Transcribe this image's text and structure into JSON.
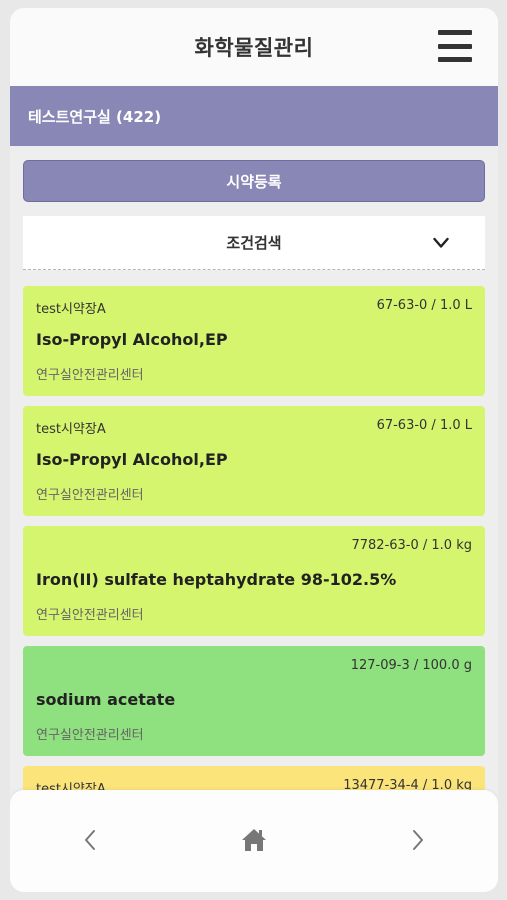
{
  "header": {
    "title": "화학물질관리",
    "menu_icon": "hamburger-menu-icon"
  },
  "lab": {
    "label": "테스트연구실 (422)"
  },
  "register_button": {
    "label": "시약등록"
  },
  "search_panel": {
    "label": "조건검색",
    "toggle_icon": "chevron-down-icon"
  },
  "colors": {
    "accent": "#8987b6",
    "card_yellow_green": "#d6f56f",
    "card_green": "#8fe07e",
    "card_yellow": "#fbe47a"
  },
  "items": [
    {
      "cabinet": "test시약장A",
      "cas_qty": "67-63-0 / 1.0 L",
      "name": "Iso-Propyl Alcohol,EP",
      "dept": "연구실안전관리센터",
      "color": "#d6f56f"
    },
    {
      "cabinet": "test시약장A",
      "cas_qty": "67-63-0 / 1.0 L",
      "name": "Iso-Propyl Alcohol,EP",
      "dept": "연구실안전관리센터",
      "color": "#d6f56f"
    },
    {
      "cabinet": "",
      "cas_qty": "7782-63-0 / 1.0 kg",
      "name": "Iron(II) sulfate heptahydrate 98-102.5%",
      "dept": "연구실안전관리센터",
      "color": "#d6f56f"
    },
    {
      "cabinet": "",
      "cas_qty": "127-09-3 / 100.0 g",
      "name": "sodium acetate",
      "dept": "연구실안전관리센터",
      "color": "#8fe07e"
    },
    {
      "cabinet": "test시약장A",
      "cas_qty": "13477-34-4 / 1.0 kg",
      "name": "",
      "dept": "",
      "color": "#fbe47a"
    }
  ],
  "bottom_nav": {
    "back_icon": "chevron-left-icon",
    "home_icon": "home-icon",
    "forward_icon": "chevron-right-icon"
  }
}
